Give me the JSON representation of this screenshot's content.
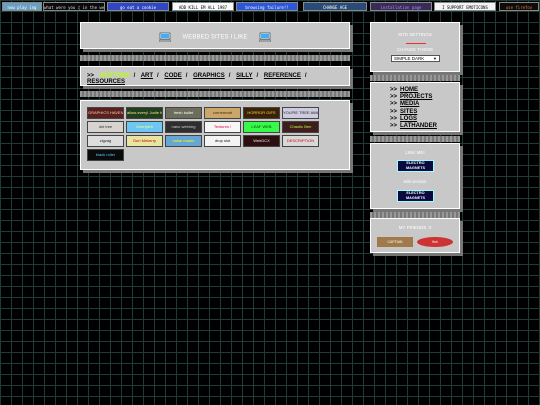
{
  "topbar": {
    "badges": [
      {
        "text": "now play ing",
        "bg": "#6b9fc1",
        "fg": "#fff"
      },
      {
        "text": "what were you ♫ in the web doing",
        "bg": "#0b0b0b",
        "fg": "#ddd"
      },
      {
        "text": "go eat a cookie",
        "bg": "#3046c4",
        "fg": "#fff"
      },
      {
        "text": "ADD KILL EM ALL 1987",
        "bg": "#fafafa",
        "fg": "#000"
      },
      {
        "text": "browsing failure!!",
        "bg": "#2b57d8",
        "fg": "#fff"
      },
      {
        "text": "CHANGE AGE",
        "bg": "#2a4b77",
        "fg": "#fff"
      },
      {
        "text": "installation page",
        "bg": "#3a2a56",
        "fg": "#b58aff"
      },
      {
        "text": "I SUPPORT EMOTICONS",
        "bg": "#f3f3f3",
        "fg": "#000"
      },
      {
        "text": "use firefox",
        "bg": "#0c0c0c",
        "fg": "#ff7a3c"
      }
    ]
  },
  "header": {
    "title": "WEBBED SITES I LIKE"
  },
  "nav": {
    "prefix": ">>",
    "items": [
      "BUTTONS",
      "ART",
      "CODE",
      "GRAPHICS",
      "SILLY",
      "REFERENCE",
      "RESOURCES"
    ],
    "active_index": 0
  },
  "buttons88": [
    {
      "text": "GRAPHICS HAVEN",
      "bg": "#5b1f1f",
      "fg": "#f2d7a5"
    },
    {
      "text": "allow-every! Jodie Kilo",
      "bg": "#1f3f1f",
      "fg": "#ffe48a"
    },
    {
      "text": "fresh bullet",
      "bg": "#6d6d5d",
      "fg": "#fff"
    },
    {
      "text": "cornermart",
      "bg": "#caa66b",
      "fg": "#4b2a00"
    },
    {
      "text": "HORROR GIFS",
      "bg": "#3a2206",
      "fg": "#ffd35a"
    },
    {
      "text": "YOU'RE TREE AWAY",
      "bg": "#cdcbe0",
      "fg": "#222"
    },
    {
      "text": "dot tree",
      "bg": "#d7d3ce",
      "fg": "#333"
    },
    {
      "text": "Ovenyieh",
      "bg": "#6cc7f5",
      "fg": "#ffff7a"
    },
    {
      "text": "nano webring",
      "bg": "#2e2e2e",
      "fg": "#ccc"
    },
    {
      "text": "Textures !",
      "bg": "#f6f6f6",
      "fg": "#e00040"
    },
    {
      "text": "LEAF WEB",
      "bg": "#37f94a",
      "fg": "#004400"
    },
    {
      "text": "Chaotic Bee",
      "bg": "#3f1d1d",
      "fg": "#b9ff3f"
    },
    {
      "text": "zigzag",
      "bg": "#ddd",
      "fg": "#222"
    },
    {
      "text": "Gurl Mekerry",
      "bg": "#e6e6a0",
      "fg": "#c00"
    },
    {
      "text": "noise maker",
      "bg": "#65a6d4",
      "fg": "#ff0"
    },
    {
      "text": "drop slot",
      "bg": "#f4f4f4",
      "fg": "#111"
    },
    {
      "text": "WeirDCX",
      "bg": "#2d0f0f",
      "fg": "#eee"
    },
    {
      "text": "DESCRIPTION",
      "bg": "#d8d8d8",
      "fg": "#c00"
    },
    {
      "text": "black roller",
      "bg": "#0a0a0a",
      "fg": "#5cf"
    }
  ],
  "settings": {
    "title": "SITE SETTINGS",
    "change_theme": "CHANGE THEME",
    "theme_value": "SIMPLE DARK"
  },
  "sidenav": {
    "prefix": ">>",
    "items": [
      "HOME",
      "PROJECTS",
      "MEDIA",
      "SITES",
      "LOGS",
      "LATHANDER"
    ]
  },
  "linkme": {
    "title": "LINK ME!",
    "button_text": "ELECTRO MAGNETS",
    "alt_label": "edit version"
  },
  "friends": {
    "title": "MY FRIENDS :3",
    "items": [
      {
        "text": "CAPTAIN",
        "bg": "#a07a4a",
        "fg": "#fff"
      },
      {
        "text": "fish",
        "bg": "#c33",
        "fg": "#fff"
      }
    ]
  },
  "colors": {
    "grid_bg": "#000000",
    "panel": "#c8c8c8",
    "active_nav": "#b8ff00",
    "accent_red": "#d33333"
  },
  "icons": {
    "header_left": "computer-icon",
    "header_right": "computer-icon"
  }
}
